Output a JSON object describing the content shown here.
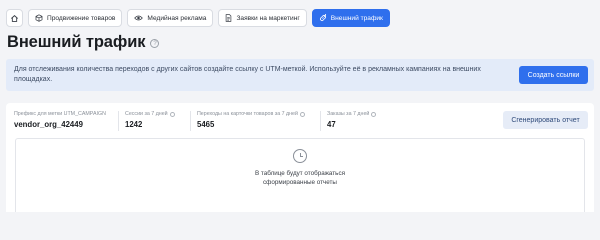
{
  "tabs": [
    {
      "label": "",
      "icon": "home-icon"
    },
    {
      "label": "Продвижение товаров",
      "icon": "cube-icon"
    },
    {
      "label": "Медийная реклама",
      "icon": "eye-icon"
    },
    {
      "label": "Заявки на маркетинг",
      "icon": "document-icon"
    },
    {
      "label": "Внешний трафик",
      "icon": "link-icon",
      "active": true
    }
  ],
  "page": {
    "title": "Внешний трафик",
    "help_glyph": "?"
  },
  "banner": {
    "text": "Для отслеживания количества переходов с других сайтов создайте ссылку с UTM-меткой. Используйте её в рекламных кампаниях на внешних площадках.",
    "button": "Создать ссылки"
  },
  "stats": [
    {
      "label": "Префикс для метки UTM_CAMPAIGN",
      "value": "vendor_org_42449"
    },
    {
      "label": "Сессии за 7 дней",
      "value": "1242"
    },
    {
      "label": "Переходы на карточки товаров за 7 дней",
      "value": "5465"
    },
    {
      "label": "Заказы за 7 дней",
      "value": "47"
    }
  ],
  "report_button": "Сгенерировать отчет",
  "empty_state": {
    "text": "В таблице будут отображаться сформированные отчеты",
    "icon": "clock-icon"
  },
  "colors": {
    "accent": "#2f6fed",
    "banner_bg": "#e3ebf9",
    "page_bg": "#f3f4f7"
  }
}
